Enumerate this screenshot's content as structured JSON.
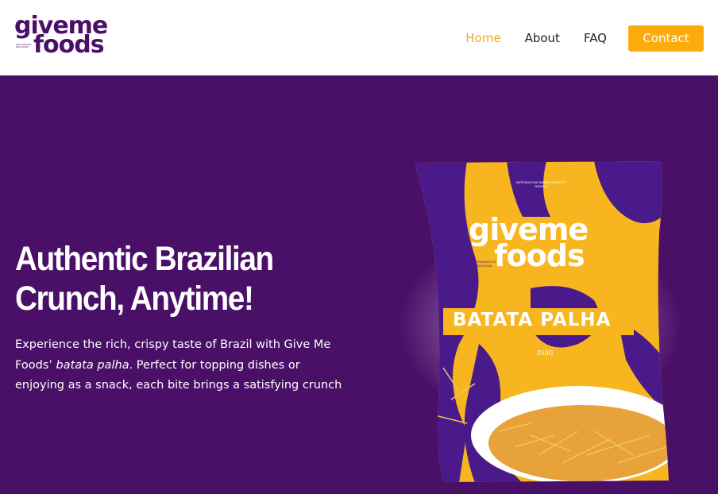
{
  "header": {
    "logo": {
      "line1": "giveme",
      "line2": "foods",
      "tagline": "CROCANTE & DELICIOSA"
    },
    "nav": [
      {
        "label": "Home",
        "active": true
      },
      {
        "label": "About",
        "active": false
      },
      {
        "label": "FAQ",
        "active": false
      }
    ],
    "contact_label": "Contact"
  },
  "hero": {
    "headline_line1": "Authentic Brazilian",
    "headline_line2": "Crunch, Anytime!",
    "desc_part1": "Experience the rich, crispy taste of  Brazil with Give  Me Foods’ ",
    "desc_italic": "batata palha",
    "desc_part2": ".  Perfect for topping dishes or enjoying as a snack, each bite brings a satisfying crunch",
    "bag": {
      "top_small": "INTRODUCING BRAND IDENTITY DESIGN",
      "brand_line1": "giveme",
      "brand_line2": "foods",
      "tagline": "CROCANTE & DELICIOSA",
      "product": "BATATA PALHA",
      "weight": "250G"
    }
  },
  "colors": {
    "brand_purple": "#4a0f66",
    "accent_orange": "#fbab0c",
    "active_nav": "#f5a623",
    "bag_yellow": "#f7b620"
  }
}
